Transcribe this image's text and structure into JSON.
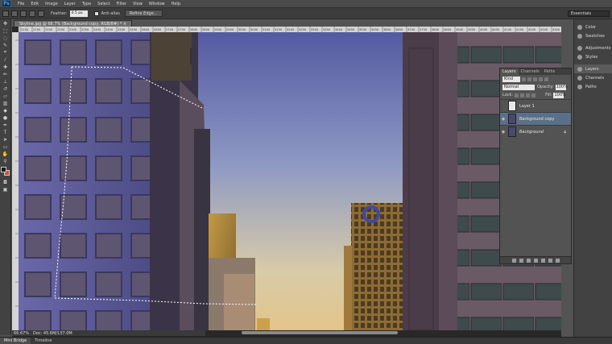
{
  "app": {
    "logo": "Ps"
  },
  "menu": [
    "File",
    "Edit",
    "Image",
    "Layer",
    "Type",
    "Select",
    "Filter",
    "View",
    "Window",
    "Help"
  ],
  "options": {
    "feather_label": "Feather:",
    "feather_value": "0.5 px",
    "anti_alias": "Anti-alias",
    "refine_edge": "Refine Edge...",
    "workspace": "Essentials"
  },
  "document": {
    "tab_title": "Skyline.jpg @ 66.7% (Background copy, RGB/8#) *",
    "zoom": "66.67%",
    "doc_size": "Doc: 45.6M/137.0M"
  },
  "ruler_h": [
    "2100",
    "2150",
    "2200",
    "2250",
    "2300",
    "2350",
    "2400",
    "2450",
    "2500",
    "2550",
    "2600",
    "2650",
    "2700",
    "2750",
    "2800",
    "2850",
    "2900",
    "2950",
    "3000",
    "3050",
    "3100",
    "3150",
    "3200",
    "3250",
    "3300",
    "3350",
    "3400",
    "3450",
    "3500",
    "3550",
    "3600",
    "3650",
    "3700",
    "3750",
    "3800",
    "3850",
    "3900",
    "3950",
    "4000",
    "4050",
    "4100",
    "4150",
    "4200",
    "4250",
    "4300"
  ],
  "dock": {
    "group1": [
      "Color",
      "Swatches"
    ],
    "group2": [
      "Adjustments",
      "Styles"
    ],
    "group3": [
      "Layers",
      "Channels",
      "Paths"
    ]
  },
  "layers_panel": {
    "tabs": [
      "Layers",
      "Channels",
      "Paths"
    ],
    "kind": "Kind",
    "blend_mode": "Normal",
    "opacity_label": "Opacity:",
    "opacity_value": "100%",
    "lock_label": "Lock:",
    "fill_label": "Fill:",
    "fill_value": "100%",
    "layers": [
      {
        "name": "Layer 1",
        "selected": false,
        "visible": false
      },
      {
        "name": "Background copy",
        "selected": true,
        "visible": true
      },
      {
        "name": "Background",
        "selected": false,
        "visible": true
      }
    ]
  },
  "bottom_tabs": [
    "Mini Bridge",
    "Timeline"
  ],
  "colors": {
    "sky_top": "#545aa2",
    "sky_bottom": "#dcc69a",
    "accent_selected_layer": "#5b6f88",
    "bg_swatch": "#d94c2f"
  }
}
